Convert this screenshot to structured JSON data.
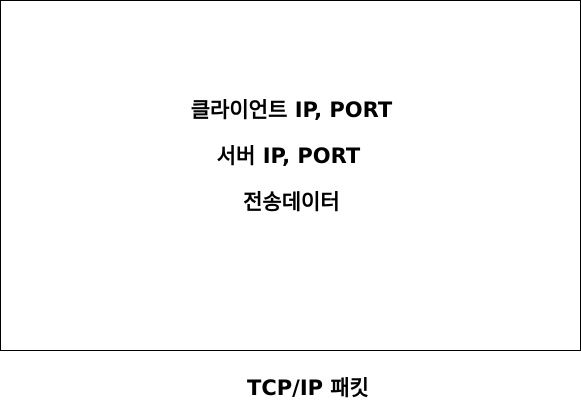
{
  "packet": {
    "fields": [
      "클라이언트 IP, PORT",
      "서버 IP, PORT",
      "전송데이터"
    ],
    "caption": "TCP/IP 패킷"
  },
  "colors": {
    "border": "#000000",
    "text": "#000000",
    "background": "#ffffff"
  }
}
